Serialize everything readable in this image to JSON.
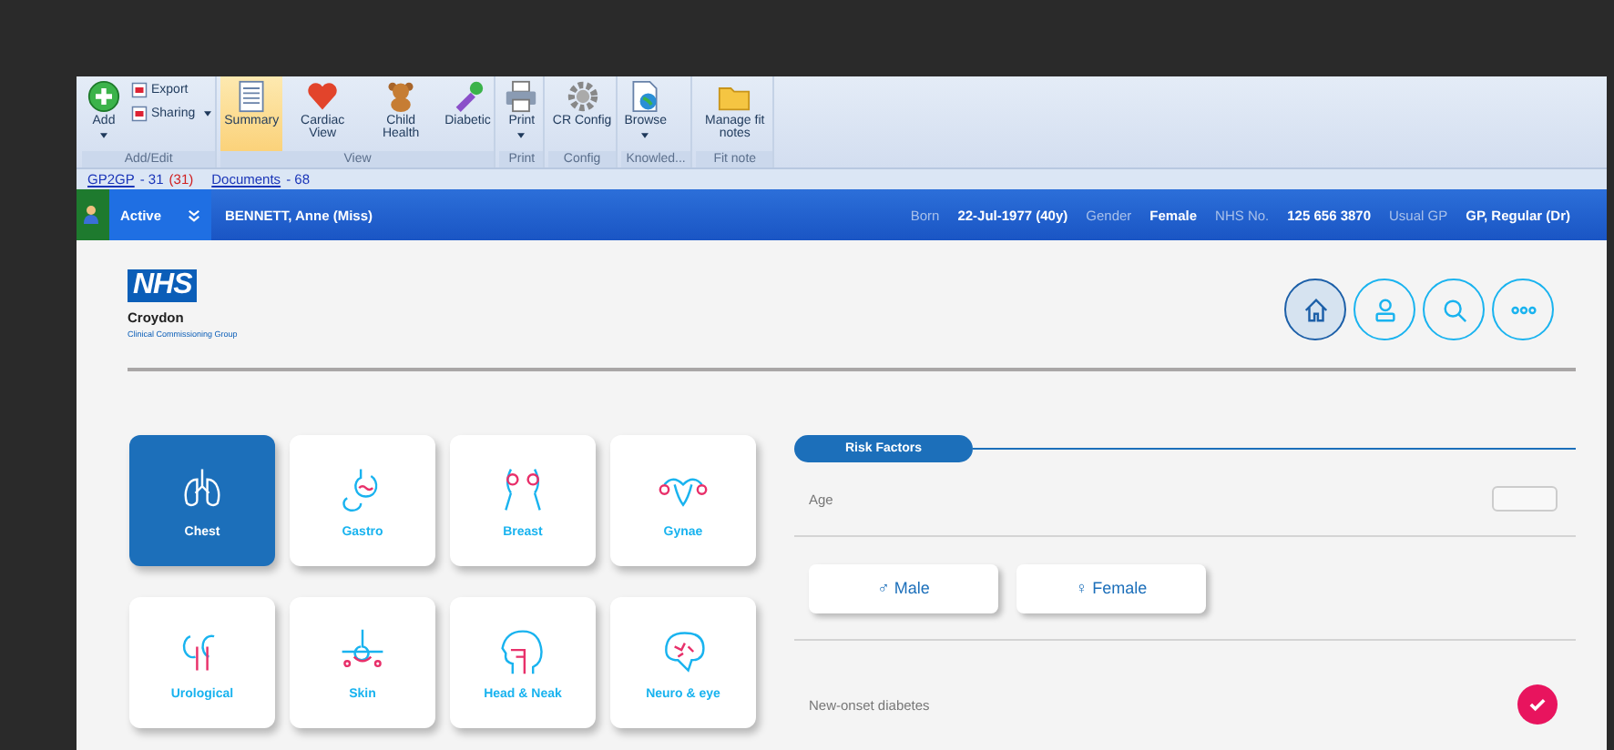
{
  "ribbon": {
    "groups": [
      {
        "label": "Add/Edit",
        "buttons": [
          {
            "label": "Add",
            "kind": "large",
            "dropdown": true,
            "selected": false
          },
          {
            "label": "Export",
            "kind": "small",
            "dropdown": false,
            "selected": false
          },
          {
            "label": "Sharing",
            "kind": "small",
            "dropdown": true,
            "selected": false
          }
        ]
      },
      {
        "label": "View",
        "buttons": [
          {
            "label": "Summary",
            "kind": "large",
            "dropdown": false,
            "selected": true
          },
          {
            "label": "Cardiac View",
            "kind": "large",
            "dropdown": false,
            "selected": false
          },
          {
            "label": "Child Health",
            "kind": "large",
            "dropdown": false,
            "selected": false
          },
          {
            "label": "Diabetic",
            "kind": "large",
            "dropdown": false,
            "selected": false
          }
        ]
      },
      {
        "label": "Print",
        "buttons": [
          {
            "label": "Print",
            "kind": "large",
            "dropdown": true,
            "selected": false
          }
        ]
      },
      {
        "label": "Config",
        "buttons": [
          {
            "label": "CR Config",
            "kind": "large",
            "dropdown": false,
            "selected": false
          }
        ]
      },
      {
        "label": "Knowled...",
        "buttons": [
          {
            "label": "Browse",
            "kind": "large",
            "dropdown": true,
            "selected": false
          }
        ]
      },
      {
        "label": "Fit note",
        "buttons": [
          {
            "label": "Manage fit notes",
            "kind": "large",
            "dropdown": false,
            "selected": false
          }
        ]
      }
    ]
  },
  "links": [
    {
      "link": "GP2GP",
      "count": "- 31",
      "extra": "(31)"
    },
    {
      "link": "Documents",
      "count": "- 68"
    }
  ],
  "patient": {
    "status": "Active",
    "name": "BENNETT,  Anne (Miss)",
    "fields": [
      {
        "label": "Born",
        "value": "22-Jul-1977 (40y)"
      },
      {
        "label": "Gender",
        "value": "Female"
      },
      {
        "label": "NHS No.",
        "value": "125 656 3870"
      },
      {
        "label": "Usual GP",
        "value": "GP, Regular (Dr)"
      }
    ]
  },
  "logo": {
    "mark": "NHS",
    "name": "Croydon",
    "subtitle": "Clinical Commissioning Group"
  },
  "nav_buttons": [
    {
      "selected": true
    },
    {
      "selected": false
    },
    {
      "selected": false
    },
    {
      "selected": false
    }
  ],
  "categories": [
    {
      "label": "Chest",
      "selected": true
    },
    {
      "label": "Gastro",
      "selected": false
    },
    {
      "label": "Breast",
      "selected": false
    },
    {
      "label": "Gynae",
      "selected": false
    },
    {
      "label": "Urological",
      "selected": false
    },
    {
      "label": "Skin",
      "selected": false
    },
    {
      "label": "Head & Neak",
      "selected": false
    },
    {
      "label": "Neuro & eye",
      "selected": false
    }
  ],
  "risk_factors": {
    "title": "Risk Factors",
    "age_label": "Age",
    "gender_options": [
      {
        "symbol": "♂",
        "label": "Male",
        "selected": false
      },
      {
        "symbol": "♀",
        "label": "Female",
        "selected": false
      }
    ],
    "diabetes": {
      "label": "New-onset diabetes",
      "checked": true
    }
  }
}
